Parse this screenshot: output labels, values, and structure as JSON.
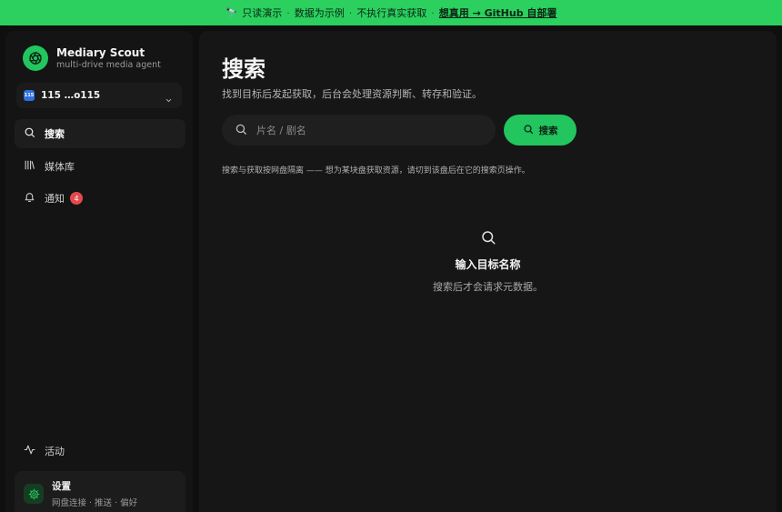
{
  "banner": {
    "icon": "🔭",
    "segments": [
      "只读演示",
      "数据为示例",
      "不执行真实获取"
    ],
    "link": "想真用 → GitHub 自部署"
  },
  "sidebar": {
    "brand_name": "Mediary Scout",
    "brand_sub": "multi-drive media agent",
    "drive_badge": "115",
    "drive_label": "115 …o115",
    "items": [
      {
        "label": "搜索",
        "icon": "search-icon"
      },
      {
        "label": "媒体库",
        "icon": "library-icon"
      },
      {
        "label": "通知",
        "icon": "bell-icon",
        "badge": "4"
      },
      {
        "label": "活动",
        "icon": "activity-icon"
      }
    ],
    "settings": {
      "title": "设置",
      "subtitle": "网盘连接 · 推送 · 偏好"
    }
  },
  "main": {
    "title": "搜索",
    "subtitle": "找到目标后发起获取，后台会处理资源判断、转存和验证。",
    "search": {
      "placeholder": "片名 / 剧名",
      "value": "",
      "button_label": "搜索"
    },
    "hint": "搜索与获取按网盘隔离 —— 想为某块盘获取资源，请切到该盘后在它的搜索页操作。",
    "empty": {
      "title": "输入目标名称",
      "subtitle": "搜索后才会请求元数据。"
    }
  },
  "colors": {
    "accent": "#22c55e",
    "banner_bg": "#2bd05f",
    "badge": "#e5484d",
    "background": "#0f0f0f"
  }
}
